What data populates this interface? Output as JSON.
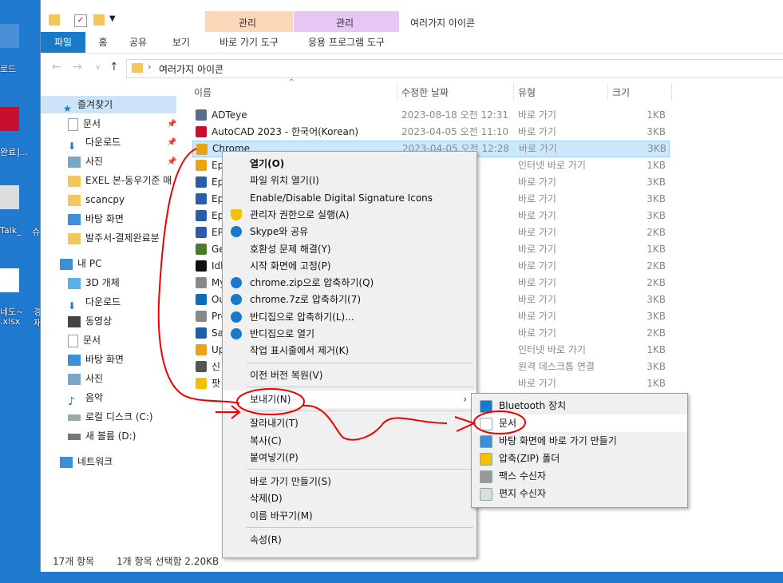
{
  "desktop": {
    "labels": [
      "로드",
      "완료]...",
      "Talk_",
      "슈",
      "네도~",
      ".xlsx",
      "경",
      "재"
    ]
  },
  "window": {
    "title": "여러가지 아이콘",
    "context_tabs": [
      {
        "group": "관리",
        "label": "바로 가기 도구",
        "color": "#fad7b9"
      },
      {
        "group": "관리",
        "label": "응용 프로그램 도구",
        "color": "#e6c7f4"
      }
    ],
    "ribbon_tabs": [
      "파일",
      "홈",
      "공유",
      "보기"
    ],
    "accent": "#1979ca"
  },
  "address": {
    "path": "여러가지 아이콘"
  },
  "sidebar": {
    "quick_access": "즐겨찾기",
    "quick_items": [
      "문서",
      "다운로드",
      "사진",
      "EXEL 본-동우기준 매",
      "scancpy",
      "바탕 화면",
      "발주서-결제완료분"
    ],
    "this_pc": "내 PC",
    "pc_items": [
      "3D 개체",
      "다운로드",
      "동영상",
      "문서",
      "바탕 화면",
      "사진",
      "음악",
      "로컬 디스크 (C:)",
      "새 볼륨 (D:)"
    ],
    "network": "네트워크"
  },
  "columns": {
    "name": "이름",
    "date": "수정한 날짜",
    "type": "유형",
    "size": "크기"
  },
  "files": [
    {
      "name": "ADTeye",
      "date": "2023-08-18 오전 12:31",
      "type": "바로 가기",
      "size": "1KB",
      "color": "#5b6b8c"
    },
    {
      "name": "AutoCAD 2023 - 한국어(Korean)",
      "date": "2023-04-05 오전 11:10",
      "type": "바로 가기",
      "size": "3KB",
      "color": "#c8102e"
    },
    {
      "name": "Chrome",
      "date": "2023-04-05 오전 12:28",
      "type": "바로 가기",
      "size": "3KB",
      "color": "#e8a317"
    },
    {
      "name": "Ep",
      "date": "2:58",
      "type": "인터넷 바로 가기",
      "size": "1KB",
      "color": "#e8a317"
    },
    {
      "name": "Ep",
      "date": "3:14",
      "type": "바로 가기",
      "size": "3KB",
      "color": "#2a5caa"
    },
    {
      "name": "Ep",
      "date": "3:14",
      "type": "바로 가기",
      "size": "3KB",
      "color": "#2a5caa"
    },
    {
      "name": "Ep",
      "date": "3:14",
      "type": "바로 가기",
      "size": "3KB",
      "color": "#2a5caa"
    },
    {
      "name": "EP",
      "date": "4:11",
      "type": "바로 가기",
      "size": "2KB",
      "color": "#2a5caa"
    },
    {
      "name": "Ge",
      "date": "12:31",
      "type": "바로 가기",
      "size": "1KB",
      "color": "#4b7b2a"
    },
    {
      "name": "Idl",
      "date": "2:56",
      "type": "바로 가기",
      "size": "2KB",
      "color": "#111111"
    },
    {
      "name": "My",
      "date": "3:14",
      "type": "바로 가기",
      "size": "2KB",
      "color": "#888888"
    },
    {
      "name": "Ou",
      "date": "6:27",
      "type": "바로 가기",
      "size": "3KB",
      "color": "#0f6cbd"
    },
    {
      "name": "Pre",
      "date": "4:12",
      "type": "바로 가기",
      "size": "3KB",
      "color": "#888888"
    },
    {
      "name": "Sa",
      "date": "2:27",
      "type": "바로 가기",
      "size": "2KB",
      "color": "#1f5fa8"
    },
    {
      "name": "Up",
      "date": "10:05",
      "type": "인터넷 바로 가기",
      "size": "1KB",
      "color": "#e8a317"
    },
    {
      "name": "신",
      "date": "2:10",
      "type": "원격 데스크톱 연결",
      "size": "3KB",
      "color": "#555555"
    },
    {
      "name": "팟",
      "date": "6:48",
      "type": "바로 가기",
      "size": "1KB",
      "color": "#f2c200"
    }
  ],
  "status": {
    "count": "17개 항목",
    "selection": "1개 항목 선택함 2.20KB"
  },
  "context_menu": {
    "groups": [
      [
        "열기(O)",
        "파일 위치 열기(I)",
        "Enable/Disable Digital Signature Icons",
        "관리자 권한으로 실행(A)",
        "Skype와 공유",
        "호환성 문제 해결(Y)",
        "시작 화면에 고정(P)",
        "chrome.zip으로 압축하기(Q)",
        "chrome.7z로 압축하기(7)",
        "반디집으로 압축하기(L)...",
        "반디집으로 열기",
        "작업 표시줄에서 제거(K)"
      ],
      [
        "이전 버전 복원(V)"
      ],
      [
        "보내기(N)"
      ],
      [
        "잘라내기(T)",
        "복사(C)",
        "붙여넣기(P)"
      ],
      [
        "바로 가기 만들기(S)",
        "삭제(D)",
        "이름 바꾸기(M)"
      ],
      [
        "속성(R)"
      ]
    ],
    "icons": {
      "3": "shield-icon",
      "4": "skype-icon",
      "7": "bandizip-icon",
      "8": "bandizip-icon",
      "9": "bandizip-icon",
      "10": "bandizip-icon"
    }
  },
  "send_to": [
    "Bluetooth 장치",
    "문서",
    "바탕 화면에 바로 가기 만들기",
    "압축(ZIP) 폴더",
    "팩스 수신자",
    "편지 수신자"
  ]
}
